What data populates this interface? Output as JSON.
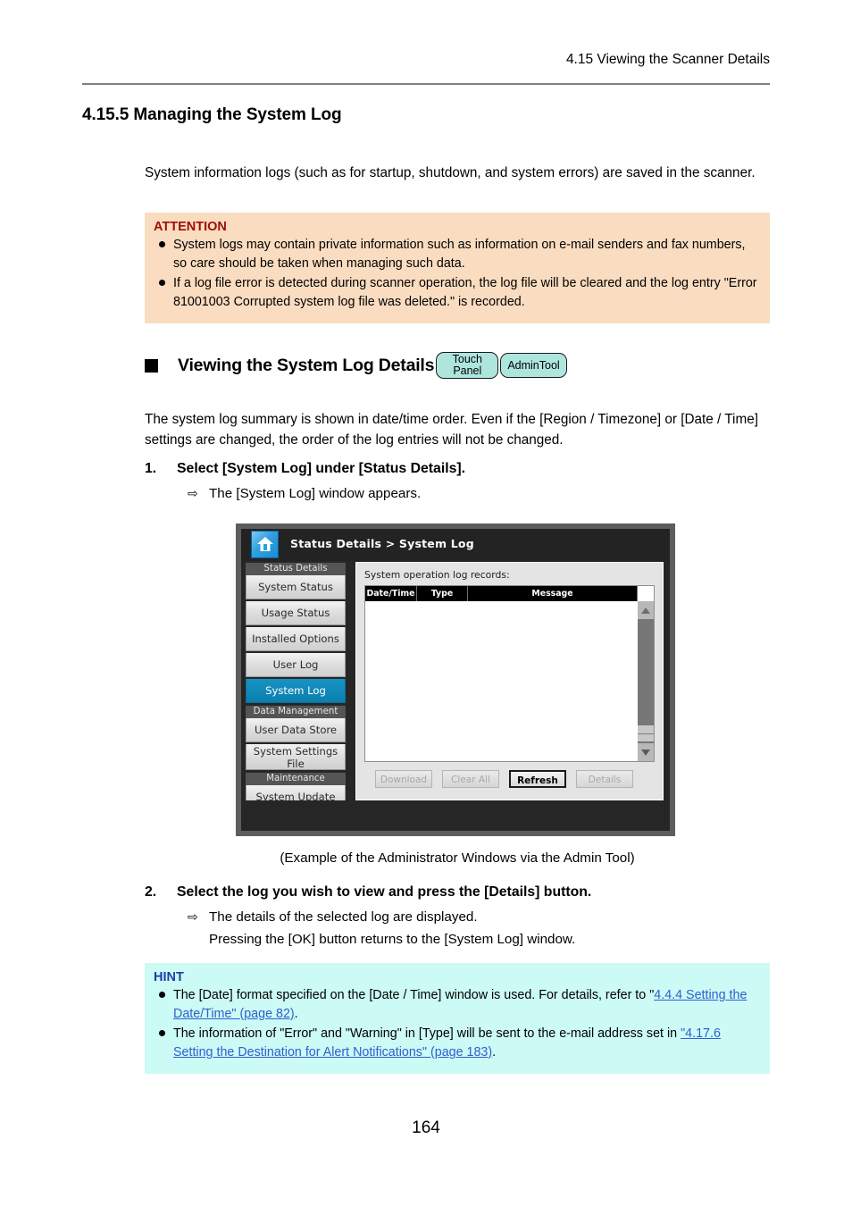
{
  "header": {
    "running_head": "4.15 Viewing the Scanner Details"
  },
  "section": {
    "number_title": "4.15.5 Managing the System Log"
  },
  "intro": {
    "text": "System information logs (such as for startup, shutdown, and system errors) are saved in the scanner."
  },
  "attention": {
    "label": "ATTENTION",
    "items": [
      "System logs may contain private information such as information on e-mail senders and fax numbers, so care should be taken when managing such data.",
      "If a log file error is detected during scanner operation, the log file will be cleared and the log entry \"Error 81001003 Corrupted system log file was deleted.\" is recorded."
    ]
  },
  "subsection": {
    "title": "Viewing the System Log Details",
    "badges": [
      {
        "line1": "Touch",
        "line2": "Panel"
      },
      {
        "line1": "AdminTool"
      }
    ]
  },
  "para2": {
    "text": "The system log summary is shown in date/time order. Even if the [Region / Timezone] or [Date / Time] settings are changed, the order of the log entries will not be changed."
  },
  "steps": [
    {
      "number": "1.",
      "title": "Select [System Log] under [Status Details].",
      "arrow": "⇨",
      "result": "The [System Log] window appears."
    },
    {
      "number": "2.",
      "title": "Select the log you wish to view and press the [Details] button.",
      "arrow": "⇨",
      "result": "The details of the selected log are displayed.",
      "extra": "Pressing the [OK] button returns to the [System Log] window."
    }
  ],
  "screenshot": {
    "breadcrumb": "Status Details > System Log",
    "home_icon": "home-icon",
    "nav": [
      {
        "type": "group",
        "label": "Status Details"
      },
      {
        "type": "item",
        "label": "System Status",
        "selected": false
      },
      {
        "type": "item",
        "label": "Usage Status",
        "selected": false
      },
      {
        "type": "item",
        "label": "Installed Options",
        "selected": false
      },
      {
        "type": "item",
        "label": "User Log",
        "selected": false
      },
      {
        "type": "item",
        "label": "System Log",
        "selected": true
      },
      {
        "type": "group",
        "label": "Data Management"
      },
      {
        "type": "item",
        "label": "User Data Store",
        "selected": false
      },
      {
        "type": "item",
        "label": "System Settings File",
        "selected": false
      },
      {
        "type": "group",
        "label": "Maintenance"
      },
      {
        "type": "item",
        "label": "System Update",
        "selected": false
      }
    ],
    "content_label": "System operation log records:",
    "table": {
      "columns": [
        "Date/Time",
        "Type",
        "Message"
      ],
      "rows": []
    },
    "buttons": [
      {
        "label": "Download",
        "enabled": false
      },
      {
        "label": "Clear All",
        "enabled": false
      },
      {
        "label": "Refresh",
        "enabled": true
      },
      {
        "label": "Details",
        "enabled": false
      }
    ]
  },
  "caption": {
    "text": "(Example of the Administrator Windows via the Admin Tool)"
  },
  "hint": {
    "label": "HINT",
    "item1_pre": "The [Date] format specified on the [Date / Time] window is used. For details, refer to \"",
    "item1_link": "4.4.4 Setting the Date/Time\" (page 82)",
    "item1_post": ".",
    "item2_pre": "The information of \"Error\" and \"Warning\" in [Type] will be sent to the e-mail address set in ",
    "item2_link": "\"4.17.6 Setting the Destination for Alert Notifications\" (page 183)",
    "item2_post": "."
  },
  "footer": {
    "page_number": "164"
  },
  "colors": {
    "attention_bg": "#fadcc0",
    "attention_label": "#9c1006",
    "hint_bg": "#ccfaf5",
    "hint_label": "#1f3fa8",
    "link": "#2f5fd0",
    "badge_bg": "#aee6de",
    "ui_selected": "#0c7fae"
  }
}
